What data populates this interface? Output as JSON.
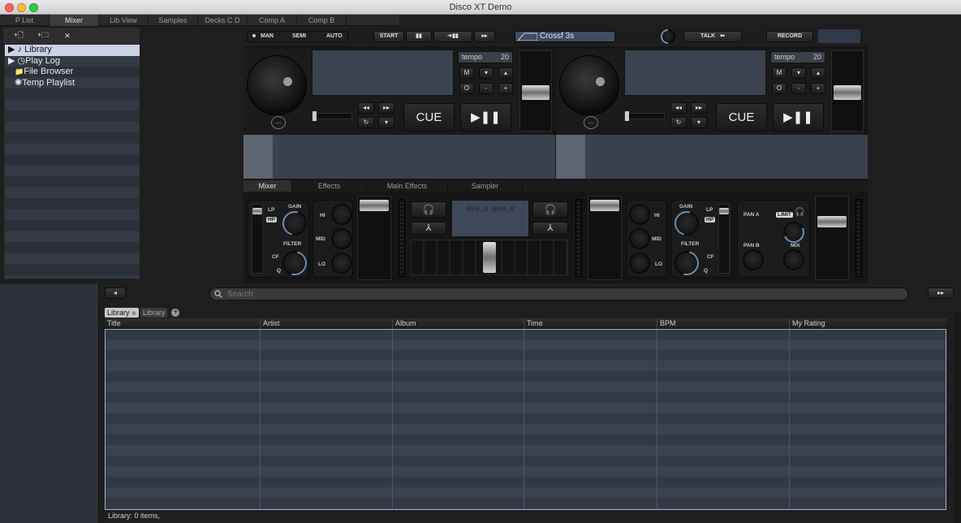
{
  "window": {
    "title": "Disco XT Demo"
  },
  "tabs": [
    "P List",
    "Mixer",
    "Lib View",
    "Samples",
    "Decks C D",
    "Comp A",
    "Comp B"
  ],
  "active_tab": "Mixer",
  "tree_toolbar": {
    "new_file": "+🗋",
    "new_folder": "+🗀",
    "close": "✕"
  },
  "tree": [
    {
      "label": "Library",
      "icon": "♪",
      "arrow": "▶",
      "selected": true
    },
    {
      "label": "Play Log",
      "icon": "◷",
      "arrow": "▶",
      "selected": false
    },
    {
      "label": "File Browser",
      "icon": "📁",
      "arrow": "",
      "selected": false
    },
    {
      "label": "Temp Playlist",
      "icon": "✺",
      "arrow": "",
      "selected": false
    }
  ],
  "transport": {
    "man": "MAN",
    "semi": "SEMI",
    "auto": "AUTO",
    "start": "START",
    "pause": "▮▮",
    "next": "➔▮▮",
    "ff": "▸▸",
    "crossfade": "Crossf 3s",
    "talk": "TALK",
    "talk_icon": "⬅",
    "record": "RECORD"
  },
  "deck_a": {
    "tempo_label": "tempo",
    "tempo_value": "20",
    "m": "M",
    "o": "O",
    "minus": "-",
    "plus": "+",
    "cue": "CUE",
    "play": "▶❚❚",
    "more": "...",
    "rew": "◂◂",
    "fwd": "▸▸"
  },
  "deck_b": {
    "tempo_label": "tempo",
    "tempo_value": "20",
    "m": "M",
    "o": "O",
    "minus": "-",
    "plus": "+",
    "cue": "CUE",
    "play": "▶❚❚",
    "more": "...",
    "rew": "◂◂",
    "fwd": "▸▸"
  },
  "mixer_tabs": [
    "Mixer",
    "Effects",
    "Main Effects",
    "Sampler"
  ],
  "mixer": {
    "gain": "GAIN",
    "filter": "FILTER",
    "lp": "LP",
    "hp": "HP",
    "cf": "CF",
    "q": "Q",
    "hi": "HI",
    "mid": "MID",
    "lo": "LO",
    "bpm_display": "000.0 000.0",
    "pan_a": "PAN A",
    "pan_b": "PAN B",
    "limit": "LIMIT",
    "mix": "MIX"
  },
  "library": {
    "search_placeholder": "Search",
    "nav_left": "◂",
    "nav_right": "▸▸",
    "tabs": [
      {
        "label": "Library",
        "active": true
      },
      {
        "label": "Library",
        "active": false
      }
    ],
    "add_tab": "+",
    "columns": [
      "Title",
      "Artist",
      "Album",
      "Time",
      "BPM",
      "My Rating"
    ],
    "status": "Library: 0 items,"
  },
  "colors": {
    "accent_blue": "#6f8cb4",
    "selection": "#c9d3e4",
    "panel": "#1a1a1a"
  }
}
